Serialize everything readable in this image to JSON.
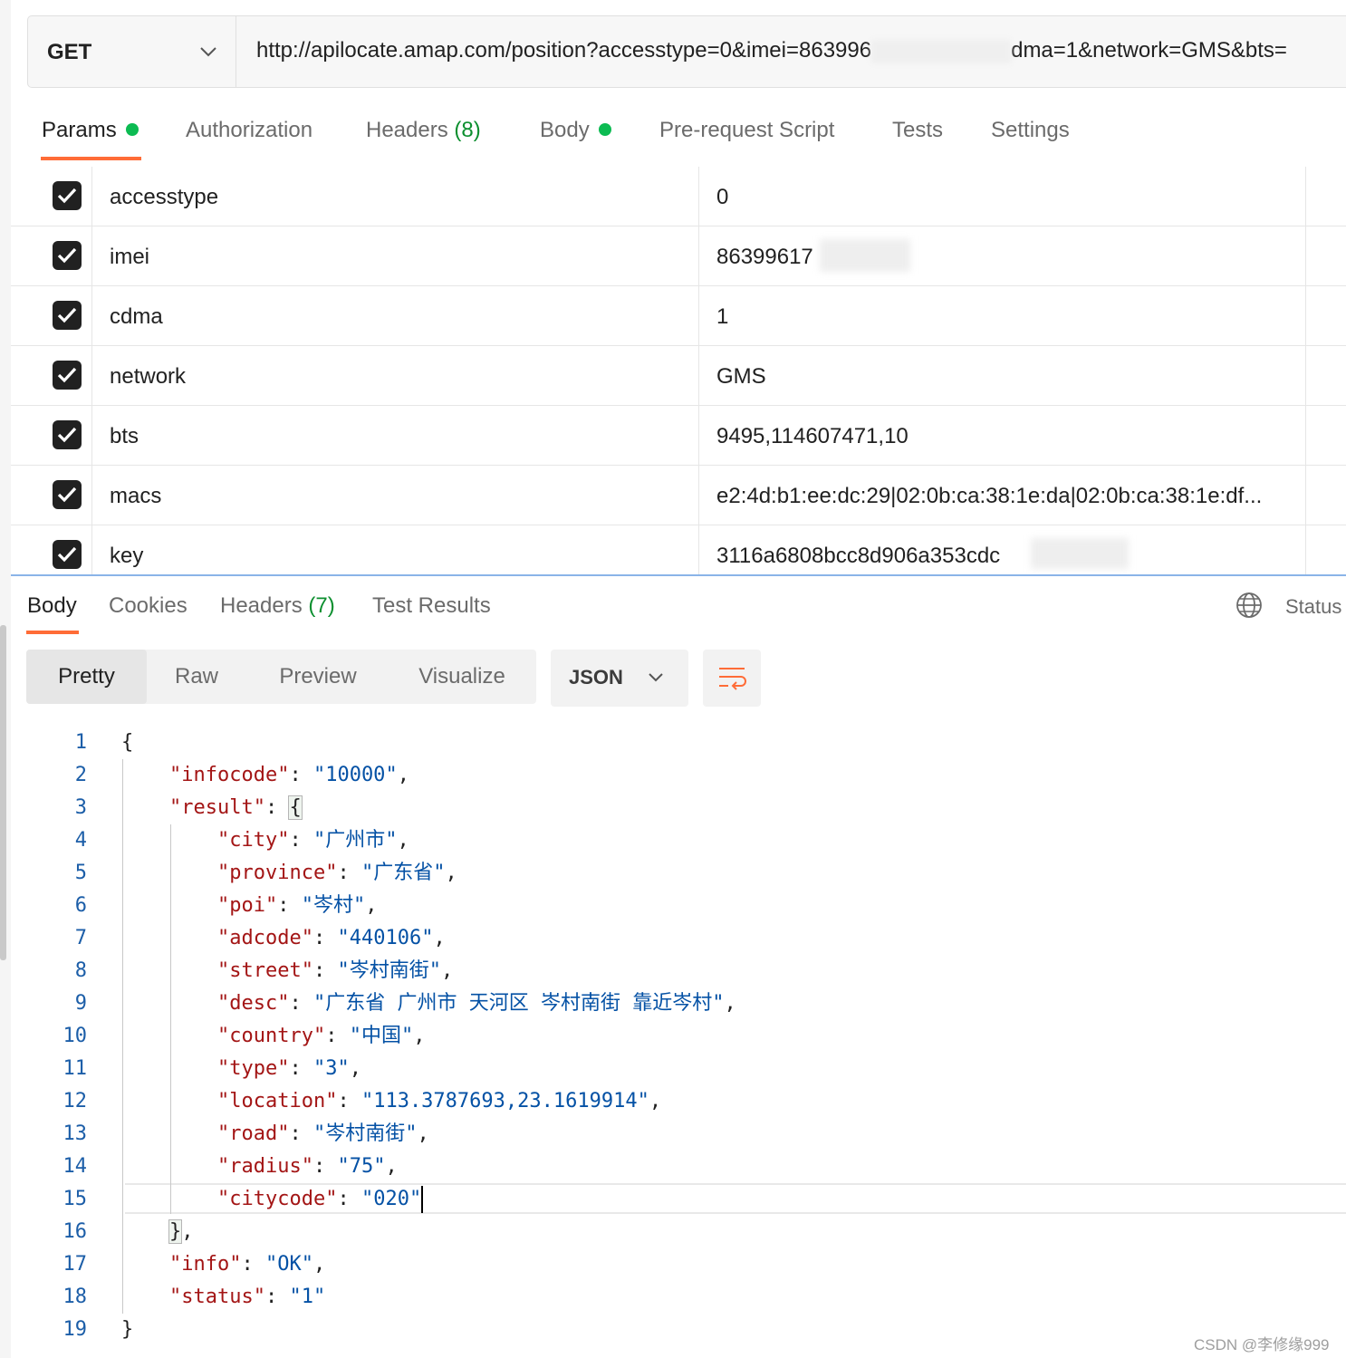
{
  "request": {
    "method": "GET",
    "url_visible_prefix": "http://apilocate.amap.com/position?accesstype=0&imei=863996",
    "url_visible_suffix": "dma=1&network=GMS&bts="
  },
  "request_tabs": [
    {
      "label": "Params",
      "has_dot": true,
      "active": true
    },
    {
      "label": "Authorization"
    },
    {
      "label": "Headers",
      "count": "(8)"
    },
    {
      "label": "Body",
      "has_dot": true
    },
    {
      "label": "Pre-request Script"
    },
    {
      "label": "Tests"
    },
    {
      "label": "Settings"
    }
  ],
  "params": [
    {
      "key": "accesstype",
      "value": "0",
      "checked": true
    },
    {
      "key": "imei",
      "value": "86399617",
      "checked": true,
      "redacted": true
    },
    {
      "key": "cdma",
      "value": "1",
      "checked": true
    },
    {
      "key": "network",
      "value": "GMS",
      "checked": true
    },
    {
      "key": "bts",
      "value": "9495,114607471,10",
      "checked": true
    },
    {
      "key": "macs",
      "value": "e2:4d:b1:ee:dc:29|02:0b:ca:38:1e:da|02:0b:ca:38:1e:df...",
      "checked": true
    },
    {
      "key": "key",
      "value": "3116a6808bcc8d906a353cdc",
      "checked": true,
      "redacted": true
    }
  ],
  "response_tabs": [
    {
      "label": "Body",
      "active": true
    },
    {
      "label": "Cookies"
    },
    {
      "label": "Headers",
      "count": "(7)"
    },
    {
      "label": "Test Results"
    }
  ],
  "status_label": "Status",
  "view_modes": [
    "Pretty",
    "Raw",
    "Preview",
    "Visualize"
  ],
  "active_view_mode": "Pretty",
  "format_select": "JSON",
  "code_lines": [
    {
      "n": "1"
    },
    {
      "n": "2"
    },
    {
      "n": "3"
    },
    {
      "n": "4"
    },
    {
      "n": "5"
    },
    {
      "n": "6"
    },
    {
      "n": "7"
    },
    {
      "n": "8"
    },
    {
      "n": "9"
    },
    {
      "n": "10"
    },
    {
      "n": "11"
    },
    {
      "n": "12"
    },
    {
      "n": "13"
    },
    {
      "n": "14"
    },
    {
      "n": "15"
    },
    {
      "n": "16"
    },
    {
      "n": "17"
    },
    {
      "n": "18"
    },
    {
      "n": "19"
    }
  ],
  "response_json": {
    "infocode": "10000",
    "city": "广州市",
    "province": "广东省",
    "poi": "岑村",
    "adcode": "440106",
    "street": "岑村南街",
    "desc": "广东省 广州市 天河区 岑村南街 靠近岑村",
    "country": "中国",
    "type": "3",
    "location": "113.3787693,23.1619914",
    "road": "岑村南街",
    "radius": "75",
    "citycode": "020",
    "info": "OK",
    "status": "1"
  },
  "watermark": "CSDN @李修缘999",
  "colors": {
    "accent": "#ff6c37",
    "json_key": "#a31515",
    "json_string": "#0451a5",
    "line_number": "#1c5ea8",
    "dot_green": "#0cbb52"
  }
}
